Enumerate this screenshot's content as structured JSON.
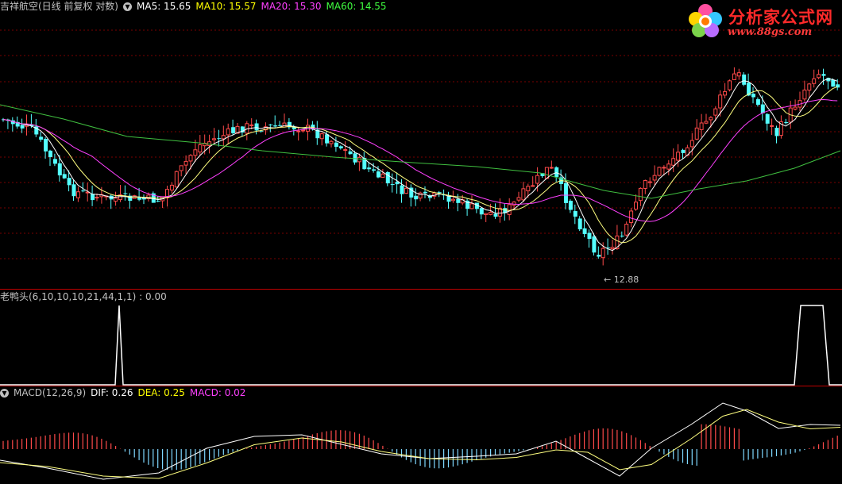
{
  "main_legend": {
    "title": "吉祥航空(日线 前复权 对数)",
    "ma5": "MA5: 15.65",
    "ma10": "MA10: 15.57",
    "ma20": "MA20: 15.30",
    "ma60": "MA60: 14.55"
  },
  "indicator_legend": {
    "text": "老鸭头(6,10,10,10,21,44,1,1) : 0.00"
  },
  "macd_legend": {
    "title": "MACD(12,26,9)",
    "dif": "DIF: 0.26",
    "dea": "DEA: 0.25",
    "macd": "MACD: 0.02"
  },
  "low_annotation": "12.88",
  "logo": {
    "title": "分析家公式网",
    "url": "www.88gs.com"
  },
  "colors": {
    "up": "#ff4a4a",
    "down": "#54ffff",
    "ma5": "#ffffff",
    "ma10": "#ffff80",
    "ma20": "#ff40ff",
    "ma60": "#40c040",
    "grid": "#7a0000",
    "separator": "#c00000"
  },
  "chart_data": {
    "type": "candlestick",
    "series": [
      "MA5",
      "MA10",
      "MA20",
      "MA60"
    ],
    "price_low": 12.88,
    "indicator_values_shown": [
      0,
      1
    ]
  }
}
